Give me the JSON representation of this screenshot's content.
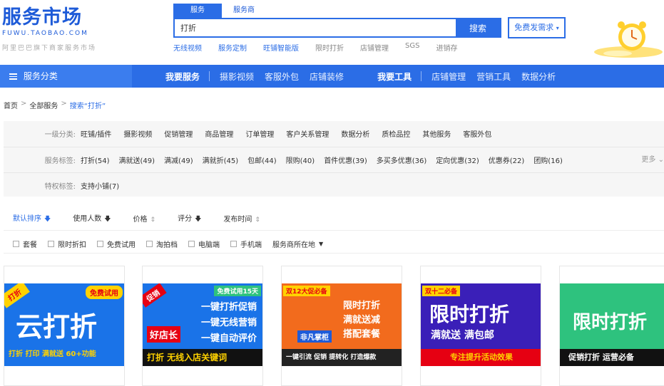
{
  "logo": {
    "main": "服务市场",
    "sub": "FUWU.TAOBAO.COM",
    "slogan": "阿里巴巴旗下商家服务市场"
  },
  "search": {
    "tabs": [
      "服务",
      "服务商"
    ],
    "value": "打折",
    "button": "搜索",
    "hot_links": [
      "无线视频",
      "服务定制",
      "旺铺智能版",
      "限时打折",
      "店铺管理",
      "SGS",
      "进销存"
    ]
  },
  "post_demand": "免费发需求",
  "nav": {
    "category": "服务分类",
    "group1_title": "我要服务",
    "group1": [
      "摄影视频",
      "客服外包",
      "店铺装修"
    ],
    "group2_title": "我要工具",
    "group2": [
      "店铺管理",
      "营销工具",
      "数据分析"
    ]
  },
  "breadcrumb": [
    "首页",
    "全部服务",
    "搜索“打折”"
  ],
  "filters": {
    "row1_label": "一级分类:",
    "row1": [
      "旺铺/插件",
      "摄影视频",
      "促销管理",
      "商品管理",
      "订单管理",
      "客户关系管理",
      "数据分析",
      "质检品控",
      "其他服务",
      "客服外包"
    ],
    "row2_label": "服务标签:",
    "row2": [
      "打折(54)",
      "满就送(49)",
      "满减(49)",
      "满就折(45)",
      "包邮(44)",
      "限购(40)",
      "首件优惠(39)",
      "多买多优惠(36)",
      "定向优惠(32)",
      "优惠券(22)",
      "团购(16)"
    ],
    "row3_label": "特权标签:",
    "row3": [
      "支持小铺(7)"
    ],
    "more": "更多"
  },
  "sort": [
    "默认排序",
    "使用人数",
    "价格",
    "评分",
    "发布时间"
  ],
  "options": [
    "套餐",
    "限时折扣",
    "免费试用",
    "淘拍档",
    "电脑端",
    "手机端"
  ],
  "location": "服务商所在地",
  "cards": [
    {
      "tag": "免费试用",
      "corner": "打折",
      "big": "云打折",
      "line": "打折 打印 满就送 60+功能"
    },
    {
      "corner": "促销",
      "tag": "免费试用15天",
      "line1": "一键打折促销",
      "line2": "一键无线营销",
      "line3": "一键自动评价",
      "brand": "好店长",
      "bottom": "打折 无线入店关键词"
    },
    {
      "tag": "双12大促必备",
      "line1": "限时打折",
      "line2": "满就送减",
      "line3": "搭配套餐",
      "brand": "非凡掌柜",
      "bottom": "一键引流 促销 提转化 打造爆款"
    },
    {
      "tag": "双十二必备",
      "big": "限时打折",
      "line1": "满就送 满包邮",
      "bottom": "专注提升活动效果"
    },
    {
      "big": "限时打折",
      "bottom": "促销打折 运营必备"
    }
  ],
  "colors": {
    "accent": "#2b6de6",
    "card_blue": "#1a73e8",
    "card_red": "#e60012",
    "card_green": "#2ec27e"
  }
}
